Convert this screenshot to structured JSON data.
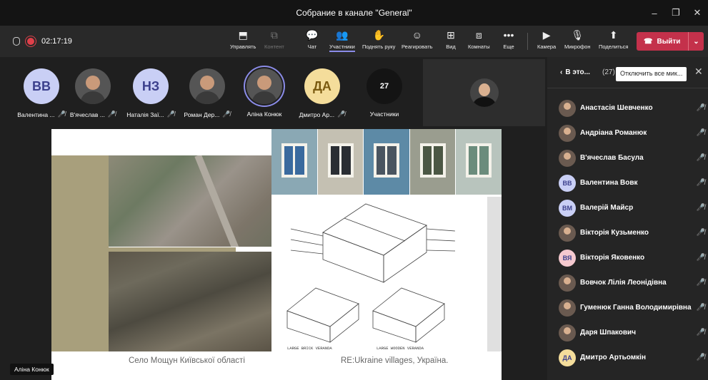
{
  "window": {
    "title": "Собрание в канале \"General\"",
    "controls": [
      "–",
      "❐",
      "✕"
    ]
  },
  "meeting": {
    "timer": "02:17:19"
  },
  "toolbar": {
    "buttons": [
      {
        "label": "Управлять",
        "icon": "share-control-icon",
        "glyph": "⬒"
      },
      {
        "label": "Контент",
        "icon": "content-icon",
        "glyph": "⧉"
      },
      {
        "label": "Чат",
        "icon": "chat-icon",
        "glyph": "💬"
      },
      {
        "label": "Участники",
        "icon": "people-icon",
        "glyph": "👥"
      },
      {
        "label": "Поднять руку",
        "icon": "raise-hand-icon",
        "glyph": "✋"
      },
      {
        "label": "Реагировать",
        "icon": "react-icon",
        "glyph": "☺"
      },
      {
        "label": "Вид",
        "icon": "view-icon",
        "glyph": "⊞"
      },
      {
        "label": "Комнаты",
        "icon": "rooms-icon",
        "glyph": "⧈"
      },
      {
        "label": "Еще",
        "icon": "more-icon",
        "glyph": "•••"
      },
      {
        "label": "Камера",
        "icon": "camera-off-icon",
        "glyph": "▶"
      },
      {
        "label": "Микрофон",
        "icon": "microphone-icon",
        "glyph": "🎙"
      },
      {
        "label": "Поделиться",
        "icon": "share-icon",
        "glyph": "⬆"
      }
    ],
    "leave_label": "Выйти"
  },
  "strip": {
    "tiles": [
      {
        "initials": "ВВ",
        "name": "Валентина ...",
        "color": "#c9cff5",
        "text": "#3b3f8c",
        "photo": false
      },
      {
        "initials": "",
        "name": "В'ячеслав ...",
        "color": "#555",
        "text": "#fff",
        "photo": true
      },
      {
        "initials": "НЗ",
        "name": "Наталія Заї...",
        "color": "#c9cff5",
        "text": "#3b3f8c",
        "photo": false
      },
      {
        "initials": "",
        "name": "Роман Дер...",
        "color": "#555",
        "text": "#fff",
        "photo": true
      },
      {
        "initials": "",
        "name": "Аліна Конюк",
        "color": "#555",
        "text": "#fff",
        "photo": true
      },
      {
        "initials": "ДА",
        "name": "Дмитро Ар...",
        "color": "#f4dd9b",
        "text": "#7a5a10",
        "photo": false
      }
    ],
    "count": "27",
    "count_label": "Участники"
  },
  "slide": {
    "caption_left": "Село Мощун Київської області",
    "caption_right": "RE:Ukraine villages, Україна.",
    "label_brick": "LARGE BRICK VERANDA",
    "label_wood": "LARGE WOODEN VERANDA"
  },
  "speaker_tag": "Аліна Конюк",
  "panel": {
    "title": "В это...",
    "count": "(27)",
    "mute_all": "Отключить все мик...",
    "participants": [
      {
        "name": "Анастасія Шевченко",
        "initials": "",
        "photo": true,
        "color": ""
      },
      {
        "name": "Андріана Романюк",
        "initials": "",
        "photo": true,
        "color": ""
      },
      {
        "name": "В'ячеслав Басула",
        "initials": "",
        "photo": true,
        "color": ""
      },
      {
        "name": "Валентина Вовк",
        "initials": "ВВ",
        "photo": false,
        "color": "#c9cff5"
      },
      {
        "name": "Валерій Майср",
        "initials": "ВМ",
        "photo": false,
        "color": "#c9cff5"
      },
      {
        "name": "Вікторія Кузьменко",
        "initials": "",
        "photo": true,
        "color": ""
      },
      {
        "name": "Вікторія Яковенко",
        "initials": "ВЯ",
        "photo": false,
        "color": "#f5c9cf"
      },
      {
        "name": "Вовчок Лілія Леонідівна",
        "initials": "",
        "photo": true,
        "color": ""
      },
      {
        "name": "Гуменюк Ганна Володимирівна",
        "initials": "",
        "photo": true,
        "color": ""
      },
      {
        "name": "Даря Шпакович",
        "initials": "",
        "photo": true,
        "color": ""
      },
      {
        "name": "Дмитро Артьомкін",
        "initials": "ДА",
        "photo": false,
        "color": "#f4dd9b"
      }
    ]
  }
}
